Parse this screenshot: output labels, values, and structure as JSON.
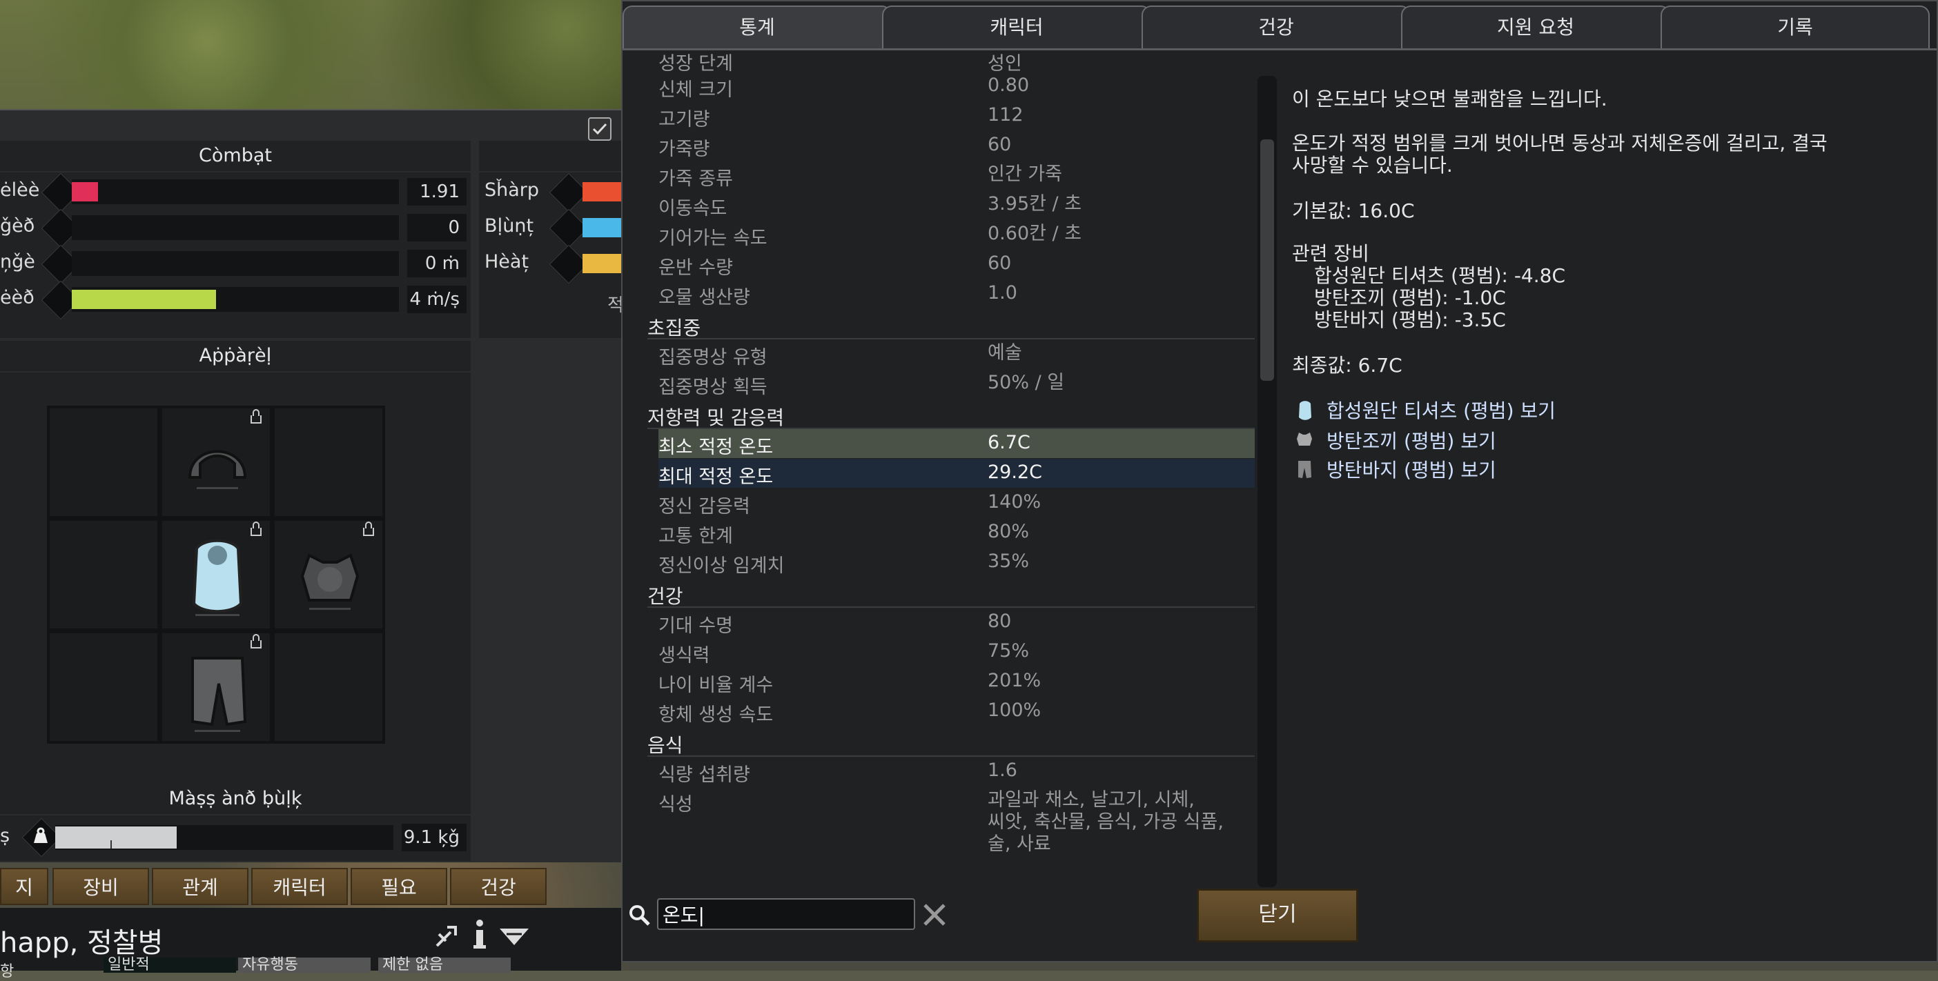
{
  "left_panel": {
    "combat": {
      "header": "Còmbạt",
      "rows": [
        {
          "label": "ėlèè",
          "value": "1.91",
          "bar_fraction": 0.08,
          "bar_color": "#e0305a"
        },
        {
          "label": "ǧèð",
          "value": "0",
          "bar_fraction": 0,
          "bar_color": "#e0305a"
        },
        {
          "label": "ņǧè",
          "value": "0 ṁ",
          "bar_fraction": 0,
          "bar_color": "#e0305a"
        },
        {
          "label": "ėèð",
          "value": "4 ṁ/ṣ",
          "bar_fraction": 0.44,
          "bar_color": "#b8d84a"
        }
      ]
    },
    "armor": {
      "rows": [
        {
          "label": "Sȟàrp",
          "bar_color": "#e85030"
        },
        {
          "label": "Bḷùṇț",
          "bar_color": "#4ab8e8"
        },
        {
          "label": "Hèàț",
          "bar_color": "#e8b840"
        }
      ],
      "cut_text": "적"
    },
    "apparel": {
      "header": "Aṗṗàṛèḷ"
    },
    "mass": {
      "header": "Màṣṣ ànð ḅùḷķ",
      "label": "ṣ",
      "value": "9.1 ķǧ",
      "bar_fraction": 0.36
    }
  },
  "bottom_tabs": [
    "지",
    "장비",
    "관계",
    "캐릭터",
    "필요",
    "건강"
  ],
  "pawn": {
    "name": "happ, 정찰병",
    "chips": [
      "일반적",
      "자유행동",
      "제한 없음"
    ],
    "chip_prefix": "항"
  },
  "stat_window": {
    "tabs": [
      "통계",
      "캐릭터",
      "건강",
      "지원 요청",
      "기록"
    ],
    "active_tab": 0,
    "partial_top_row": [
      "성장 단계",
      "성인"
    ],
    "sections": [
      {
        "type": "row",
        "key": "신체 크기",
        "value": "0.80"
      },
      {
        "type": "row",
        "key": "고기량",
        "value": "112"
      },
      {
        "type": "row",
        "key": "가죽량",
        "value": "60"
      },
      {
        "type": "row",
        "key": "가죽 종류",
        "value": "인간 가죽"
      },
      {
        "type": "row",
        "key": "이동속도",
        "value": "3.95칸 / 초"
      },
      {
        "type": "row",
        "key": "기어가는 속도",
        "value": "0.60칸 / 초"
      },
      {
        "type": "row",
        "key": "운반 수량",
        "value": "60"
      },
      {
        "type": "row",
        "key": "오물 생산량",
        "value": "1.0"
      },
      {
        "type": "cat",
        "key": "초집중"
      },
      {
        "type": "row",
        "key": "집중명상 유형",
        "value": "예술"
      },
      {
        "type": "row",
        "key": "집중명상 획득",
        "value": "50% / 일"
      },
      {
        "type": "cat",
        "key": "저항력 및 감응력"
      },
      {
        "type": "row",
        "key": "최소 적정 온도",
        "value": "6.7C",
        "highlight": "selected"
      },
      {
        "type": "row",
        "key": "최대 적정 온도",
        "value": "29.2C",
        "highlight": "match"
      },
      {
        "type": "row",
        "key": "정신 감응력",
        "value": "140%"
      },
      {
        "type": "row",
        "key": "고통 한계",
        "value": "80%"
      },
      {
        "type": "row",
        "key": "정신이상 임계치",
        "value": "35%"
      },
      {
        "type": "cat",
        "key": "건강"
      },
      {
        "type": "row",
        "key": "기대 수명",
        "value": "80"
      },
      {
        "type": "row",
        "key": "생식력",
        "value": "75%"
      },
      {
        "type": "row",
        "key": "나이 비율 계수",
        "value": "201%"
      },
      {
        "type": "row",
        "key": "항체 생성 속도",
        "value": "100%"
      },
      {
        "type": "cat",
        "key": "음식"
      },
      {
        "type": "row",
        "key": "식량 섭취량",
        "value": "1.6"
      },
      {
        "type": "row",
        "key": "식성",
        "value": "과일과 채소, 날고기, 시체,\n씨앗, 축산물, 음식, 가공 식품,\n술, 사료"
      }
    ],
    "description": {
      "line1": "이 온도보다 낮으면 불쾌함을 느낍니다.",
      "line2": "온도가 적정 범위를 크게 벗어나면 동상과 저체온증에 걸리고, 결국",
      "line3": "사망할 수 있습니다.",
      "base": "기본값: 16.0C",
      "related_header": "관련 장비",
      "related": [
        "합성원단 티셔츠 (평범): -4.8C",
        "방탄조끼 (평범): -1.0C",
        "방탄바지 (평범): -3.5C"
      ],
      "final": "최종값: 6.7C"
    },
    "links": [
      "합성원단 티셔츠 (평범) 보기",
      "방탄조끼 (평범) 보기",
      "방탄바지 (평범) 보기"
    ],
    "search_value": "온도|",
    "close_label": "닫기"
  },
  "colors": {
    "accent_gold": "#6b5330",
    "selected_row": "#4a5248",
    "match_row": "#1e2a3a"
  }
}
